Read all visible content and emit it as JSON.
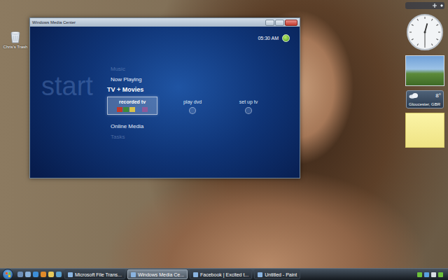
{
  "desktop": {
    "icons": [
      {
        "label": "Chris's Trash"
      }
    ]
  },
  "window": {
    "title": "Windows Media Center",
    "clock": "05:30 AM",
    "start_label": "start",
    "menu": [
      {
        "label": "Music",
        "selected": false,
        "dimmed": true
      },
      {
        "label": "Now Playing",
        "selected": false,
        "dimmed": false
      },
      {
        "label": "TV + Movies",
        "selected": true,
        "dimmed": false
      },
      {
        "label": "Online Media",
        "selected": false,
        "dimmed": false
      },
      {
        "label": "Tasks",
        "selected": false,
        "dimmed": true
      }
    ],
    "submenu": [
      {
        "label": "recorded tv",
        "selected": true
      },
      {
        "label": "play dvd",
        "selected": false
      },
      {
        "label": "set up tv",
        "selected": false
      }
    ]
  },
  "gadgets": {
    "analog_clock": {
      "hours": 12,
      "minutes": 30
    },
    "weather": {
      "temperature": "8°",
      "location": "Gloucester, GBR"
    }
  },
  "taskbar": {
    "tasks": [
      {
        "label": "Microsoft File Trans...",
        "selected": false
      },
      {
        "label": "Windows Media Ce...",
        "selected": true
      },
      {
        "label": "Facebook | Excited t...",
        "selected": false
      },
      {
        "label": "Untitled - Paint",
        "selected": false
      }
    ]
  }
}
